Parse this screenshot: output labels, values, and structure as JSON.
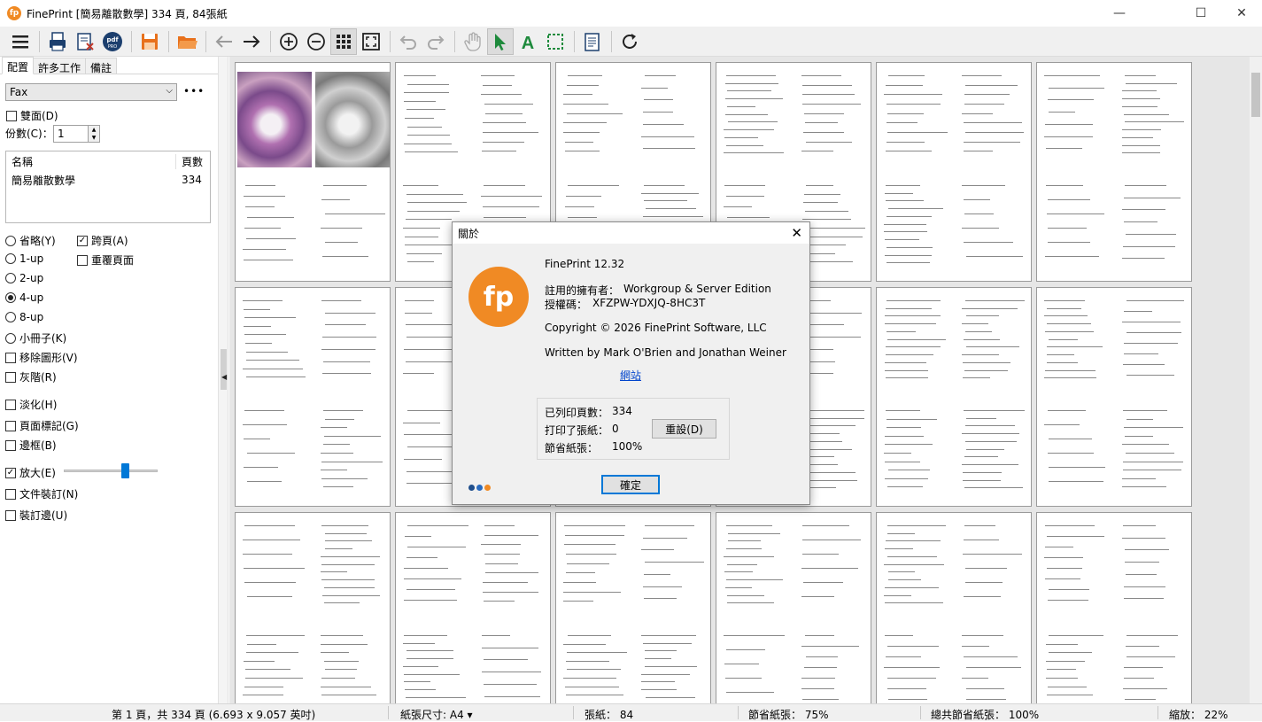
{
  "window": {
    "title": "FinePrint [簡易離散數學] 334 頁, 84張紙",
    "app_logo_text": "fp"
  },
  "tabs": [
    "配置",
    "許多工作",
    "備註"
  ],
  "printer": {
    "selected": "Fax",
    "more": "•••"
  },
  "options": {
    "duplex": "雙面(D)",
    "copies_label": "份數(C)：",
    "copies_value": "1"
  },
  "job_table": {
    "headers": [
      "名稱",
      "頁數"
    ],
    "rows": [
      {
        "name": "簡易離散數學",
        "pages": "334"
      }
    ]
  },
  "layout_radios": {
    "items": [
      "省略(Y)",
      "1-up",
      "2-up",
      "4-up",
      "8-up",
      "小冊子(K)",
      "移除圖形(V)",
      "灰階(R)"
    ],
    "selected": "4-up"
  },
  "right_checks": {
    "cross_page": "跨頁(A)",
    "overlay": "重覆頁面"
  },
  "checks": {
    "fade": "淡化(H)",
    "page_marks": "頁面標記(G)",
    "borders": "邊框(B)",
    "enlarge": "放大(E)",
    "binding": "文件裝訂(N)",
    "gutter": "裝訂邊(U)"
  },
  "enlarge_level": 0.65,
  "toolbar_icons": [
    "menu-icon",
    "print-icon",
    "delete-job-icon",
    "pdf-pro-icon",
    "save-icon",
    "open-icon",
    "back-icon",
    "forward-icon",
    "zoom-in-icon",
    "zoom-out-icon",
    "grid-view-icon",
    "fit-icon",
    "undo-icon",
    "redo-icon",
    "hand-icon",
    "select-arrow-icon",
    "text-icon",
    "crop-icon",
    "notes-icon",
    "refresh-icon"
  ],
  "dialog": {
    "title": "關於",
    "logo_text": "fp",
    "version": "FinePrint 12.32",
    "owner_label": "註用的擁有者：",
    "owner_value": "Workgroup & Server Edition",
    "license_label": "授權碼：",
    "license_value": "XFZPW-YDXJQ-8HC3T",
    "copyright": "Copyright © 2026 FinePrint Software, LLC",
    "authors": "Written by Mark O'Brien and Jonathan Weiner",
    "website": "網站",
    "stats": [
      {
        "label": "已列印頁數：",
        "value": "334"
      },
      {
        "label": "打印了張紙：",
        "value": "0"
      },
      {
        "label": "節省紙張：",
        "value": "100%"
      }
    ],
    "reset_button": "重設(D)",
    "ok_button": "確定",
    "dot_colors": [
      "#1f4e8c",
      "#2a6bbf",
      "#f08a24"
    ]
  },
  "statusbar": {
    "page_info": "第 1 頁，共 334 頁 (6.693 x 9.057 英吋)",
    "paper_size": "紙張尺寸: A4",
    "sheets": "張紙：  84",
    "saved": "節省紙張：  75%",
    "total_saved": "總共節省紙張：  100%",
    "zoom": "縮放：  22%"
  },
  "colors": {
    "accent": "#0078d7",
    "brand": "#f08a24"
  }
}
